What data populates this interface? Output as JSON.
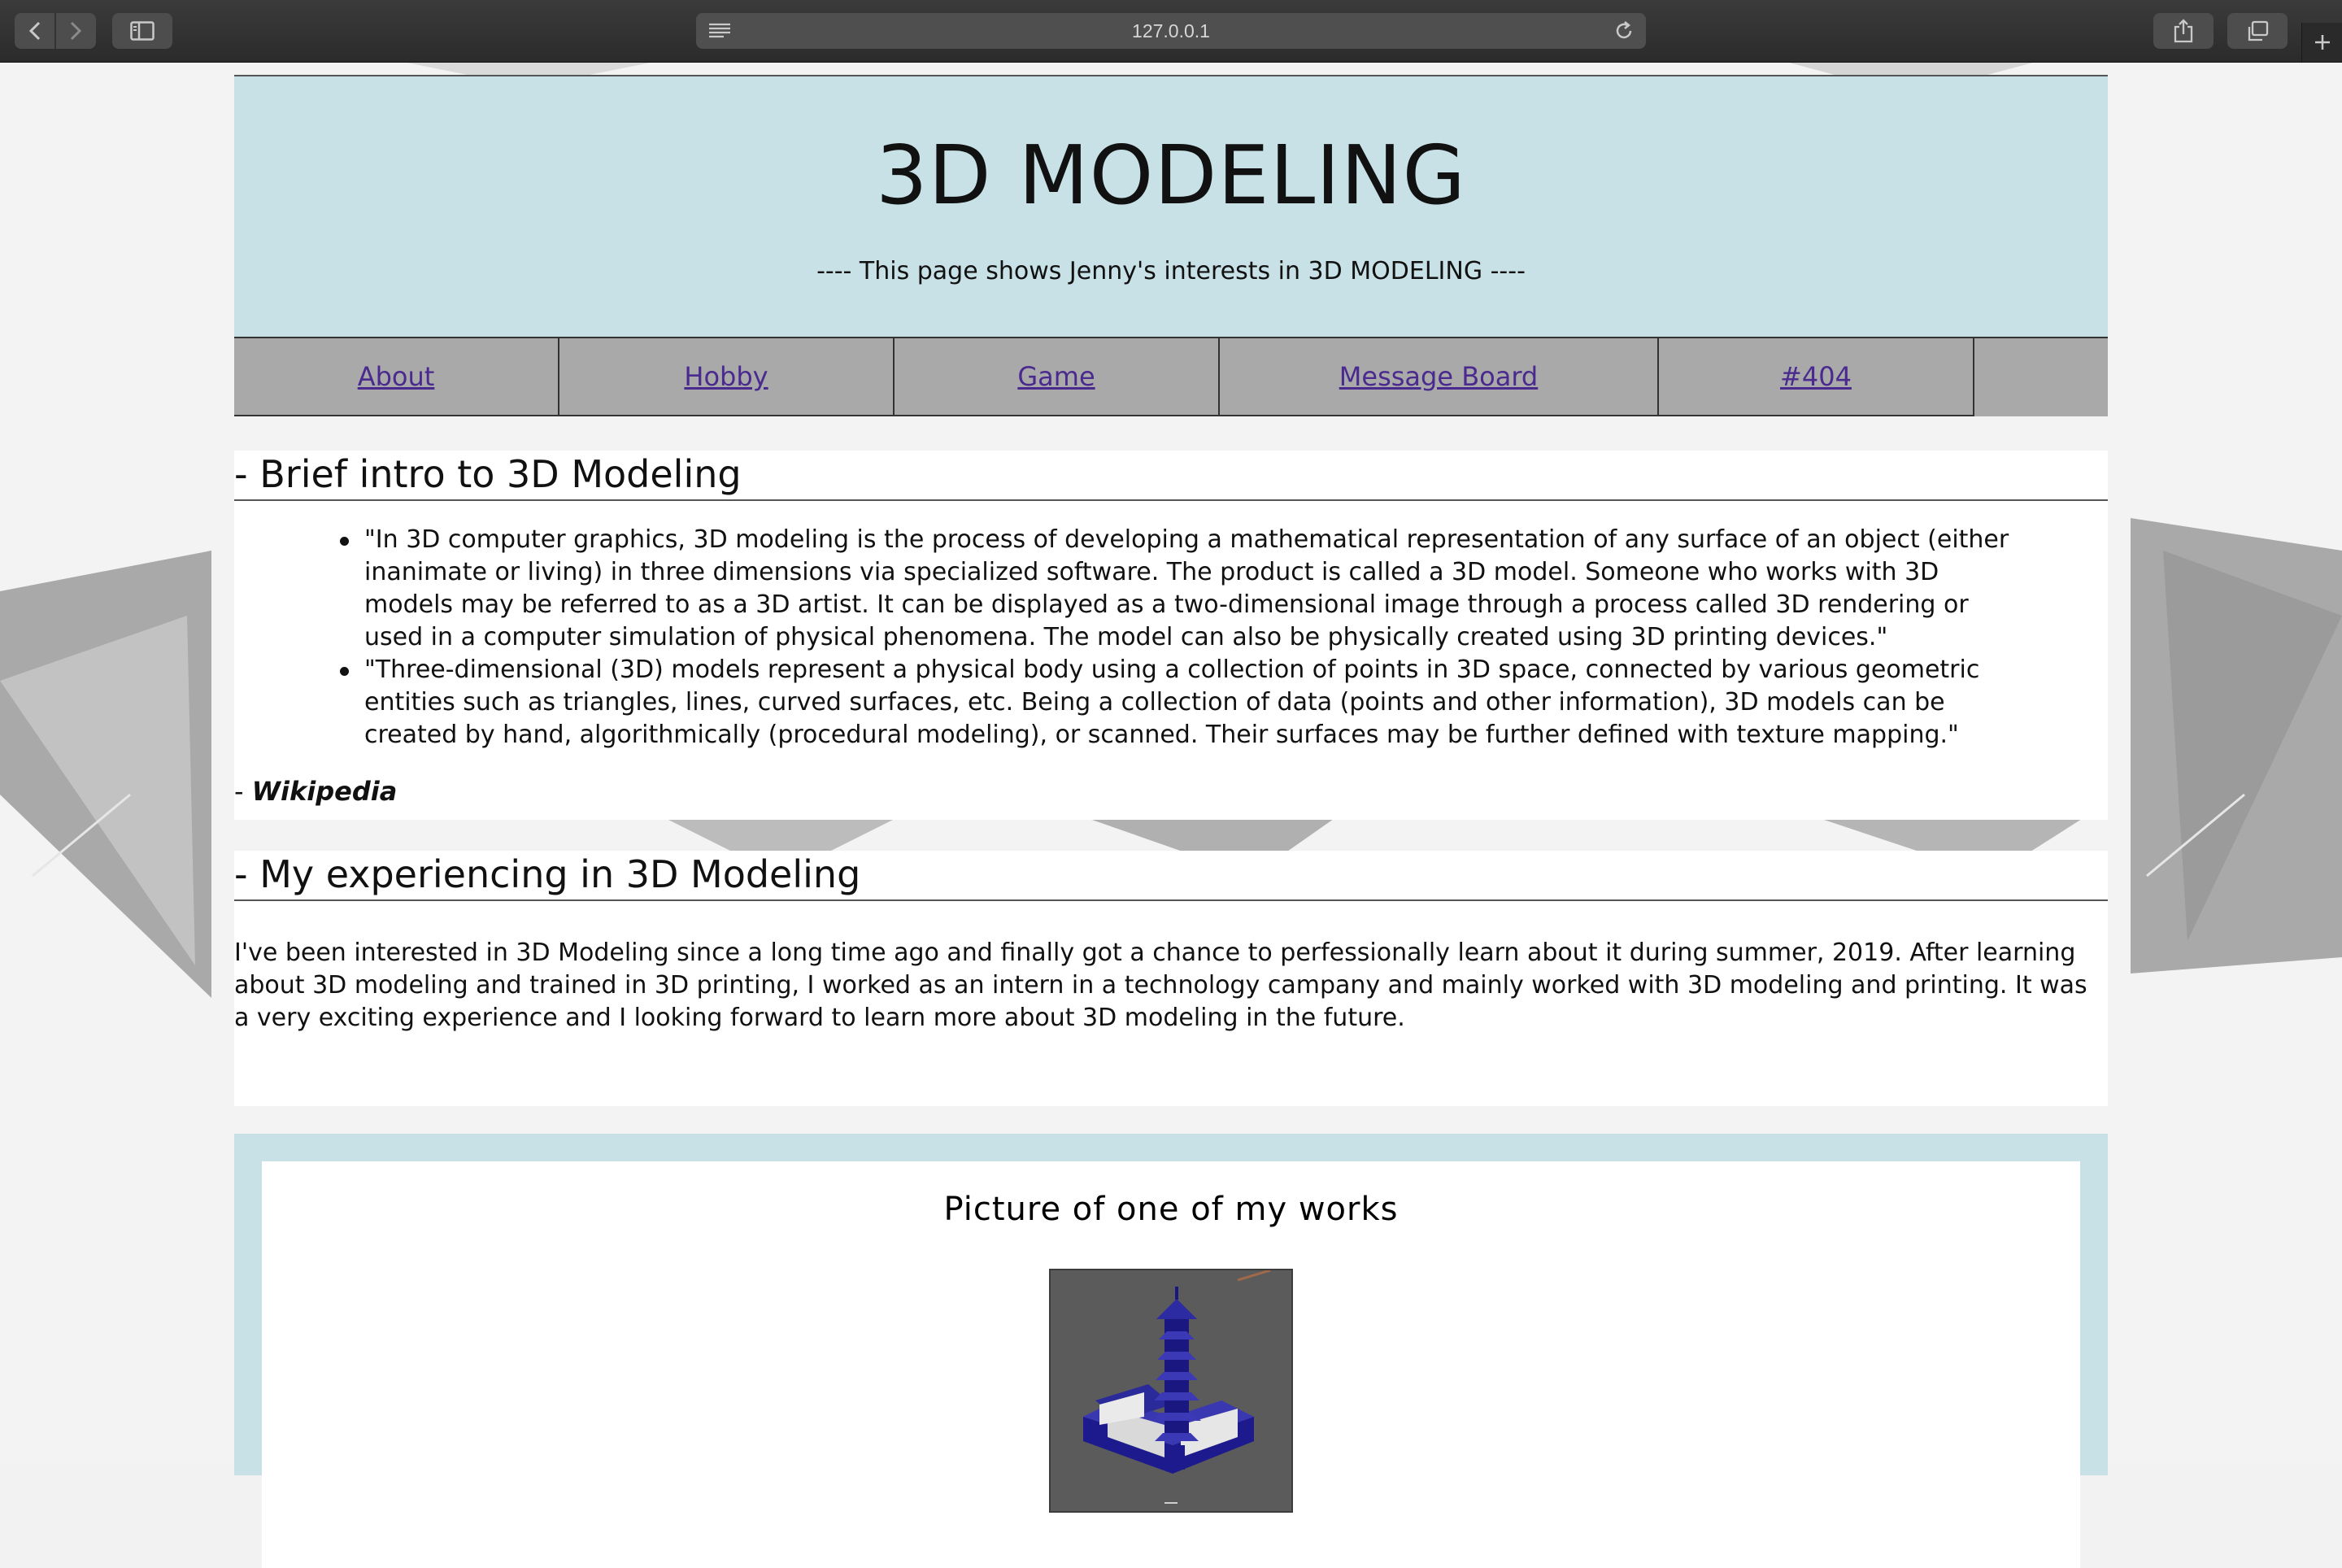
{
  "browser": {
    "url": "127.0.0.1"
  },
  "header": {
    "title": "3D MODELING",
    "subtitle": "---- This page shows Jenny's interests in 3D MODELING ----"
  },
  "nav": {
    "items": [
      {
        "label": "About"
      },
      {
        "label": "Hobby"
      },
      {
        "label": "Game"
      },
      {
        "label": "Message Board"
      },
      {
        "label": "#404"
      }
    ]
  },
  "intro": {
    "heading": "- Brief intro to 3D Modeling",
    "bullets": [
      "\"In 3D computer graphics, 3D modeling is the process of developing a mathematical representation of any surface of an object (either inanimate or living) in three dimensions via specialized software. The product is called a 3D model. Someone who works with 3D models may be referred to as a 3D artist. It can be displayed as a two-dimensional image through a process called 3D rendering or used in a computer simulation of physical phenomena. The model can also be physically created using 3D printing devices.\"",
      "\"Three-dimensional (3D) models represent a physical body using a collection of points in 3D space, connected by various geometric entities such as triangles, lines, curved surfaces, etc. Being a collection of data (points and other information), 3D models can be created by hand, algorithmically (procedural modeling), or scanned. Their surfaces may be further defined with texture mapping.\""
    ],
    "source_prefix": "- ",
    "source": "Wikipedia"
  },
  "experience": {
    "heading": "- My experiencing in 3D Modeling",
    "body": "I've been interested in 3D Modeling since a long time ago and finally got a chance to perfessionally learn about it during summer, 2019. After learning about 3D modeling and trained in 3D printing, I worked as an intern in a technology campany and mainly worked with 3D modeling and printing. It was a very exciting experience and I looking forward to learn more about 3D modeling in the future."
  },
  "gallery": {
    "title": "Picture of one of my works"
  },
  "colors": {
    "header_bg": "#c8e1e6",
    "nav_bg": "#a9a9a9",
    "link": "#4a2a8e",
    "model_blue": "#1c1a8c"
  }
}
